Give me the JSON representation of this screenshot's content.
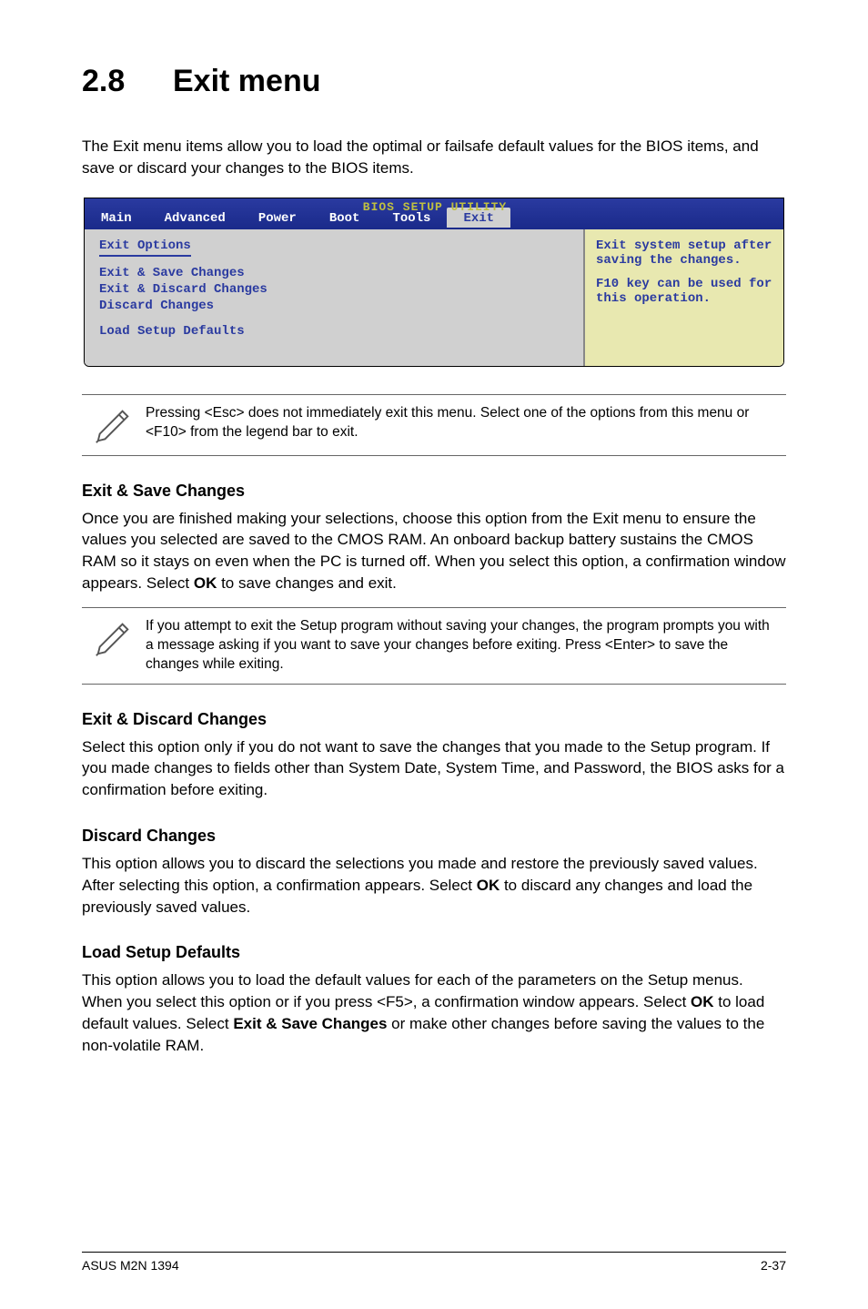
{
  "heading": {
    "number": "2.8",
    "title": "Exit menu"
  },
  "intro": "The Exit menu items allow you to load the optimal or failsafe default values for the BIOS items, and save or discard your changes to the BIOS items.",
  "bios": {
    "utility_title": "BIOS SETUP UTILITY",
    "tabs": [
      "Main",
      "Advanced",
      "Power",
      "Boot",
      "Tools",
      "Exit"
    ],
    "selected_tab_index": 5,
    "left": {
      "header": "Exit Options",
      "items": [
        "Exit & Save Changes",
        "Exit & Discard Changes",
        "Discard Changes"
      ],
      "last": "Load Setup Defaults"
    },
    "right": {
      "line1": "Exit system setup after saving the changes.",
      "line2": "F10 key can be used for this operation."
    }
  },
  "note1": "Pressing <Esc> does not immediately exit this menu. Select one of the options from this menu or <F10> from the legend bar to exit.",
  "s1": {
    "title": "Exit & Save Changes",
    "body_pre": "Once you are finished making your selections, choose this option from the Exit menu to ensure the values you selected are saved to the CMOS RAM. An onboard backup battery sustains the CMOS RAM so it stays on even when the PC is turned off. When you select this option, a confirmation window appears. Select ",
    "ok": "OK",
    "body_post": " to save changes and exit."
  },
  "note2": " If you attempt to exit the Setup program without saving your changes, the program prompts you with a message asking if you want to save your changes before exiting. Press <Enter>  to save the  changes while exiting.",
  "s2": {
    "title": "Exit & Discard Changes",
    "body": "Select this option only if you do not want to save the changes that you  made to the Setup program. If you made changes to fields other than System Date, System Time, and Password, the BIOS asks for a confirmation before exiting."
  },
  "s3": {
    "title": "Discard Changes",
    "body_pre": "This option allows you to discard the selections you made and restore the previously saved values. After selecting this option, a confirmation appears. Select ",
    "ok": "OK",
    "body_post": " to discard any changes and load the previously saved values."
  },
  "s4": {
    "title": "Load Setup Defaults",
    "body_pre": "This option allows you to load the default values for each of the parameters on the Setup menus. When you select this option or if you press <F5>, a confirmation window appears. Select ",
    "ok1": "OK",
    "body_mid": " to load default values. Select ",
    "exit_save": "Exit & Save Changes",
    "body_post": " or make other changes before saving the values to the non-volatile RAM."
  },
  "footer": {
    "left": "ASUS M2N 1394",
    "right": "2-37"
  }
}
